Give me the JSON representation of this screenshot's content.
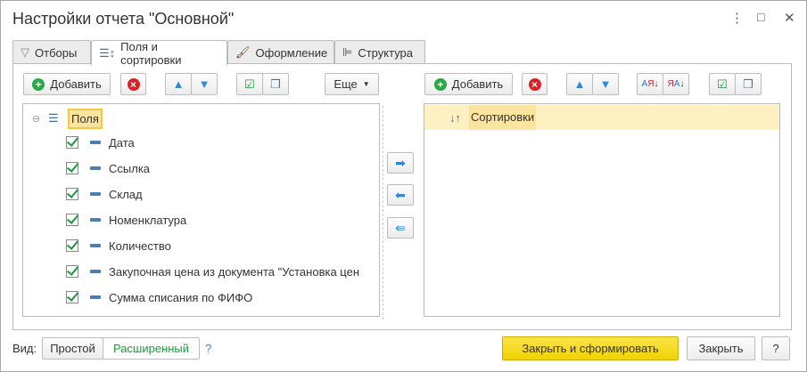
{
  "window": {
    "title": "Настройки отчета \"Основной\"",
    "more": "⋮",
    "maximize": "□",
    "close": "✕"
  },
  "tabs": [
    {
      "label": "Отборы",
      "icon": "filter-icon"
    },
    {
      "label": "Поля и сортировки",
      "icon": "fields-sort-icon",
      "active": true
    },
    {
      "label": "Оформление",
      "icon": "brush-icon"
    },
    {
      "label": "Структура",
      "icon": "structure-icon"
    }
  ],
  "left": {
    "add": "Добавить",
    "more": "Еще",
    "root": "Поля",
    "fields": [
      "Дата",
      "Ссылка",
      "Склад",
      "Номенклатура",
      "Количество",
      "Закупочная цена из документа \"Установка цен",
      "Сумма списания по ФИФО"
    ]
  },
  "right": {
    "add": "Добавить",
    "root": "Сортировки"
  },
  "bottom": {
    "view_label": "Вид:",
    "simple": "Простой",
    "extended": "Расширенный",
    "help": "?",
    "close_generate": "Закрыть и сформировать",
    "close": "Закрыть",
    "help_btn": "?"
  },
  "colors": {
    "accent_yellow": "#f5d800",
    "selection": "#fdf1c4",
    "green": "#1a9a3a"
  }
}
